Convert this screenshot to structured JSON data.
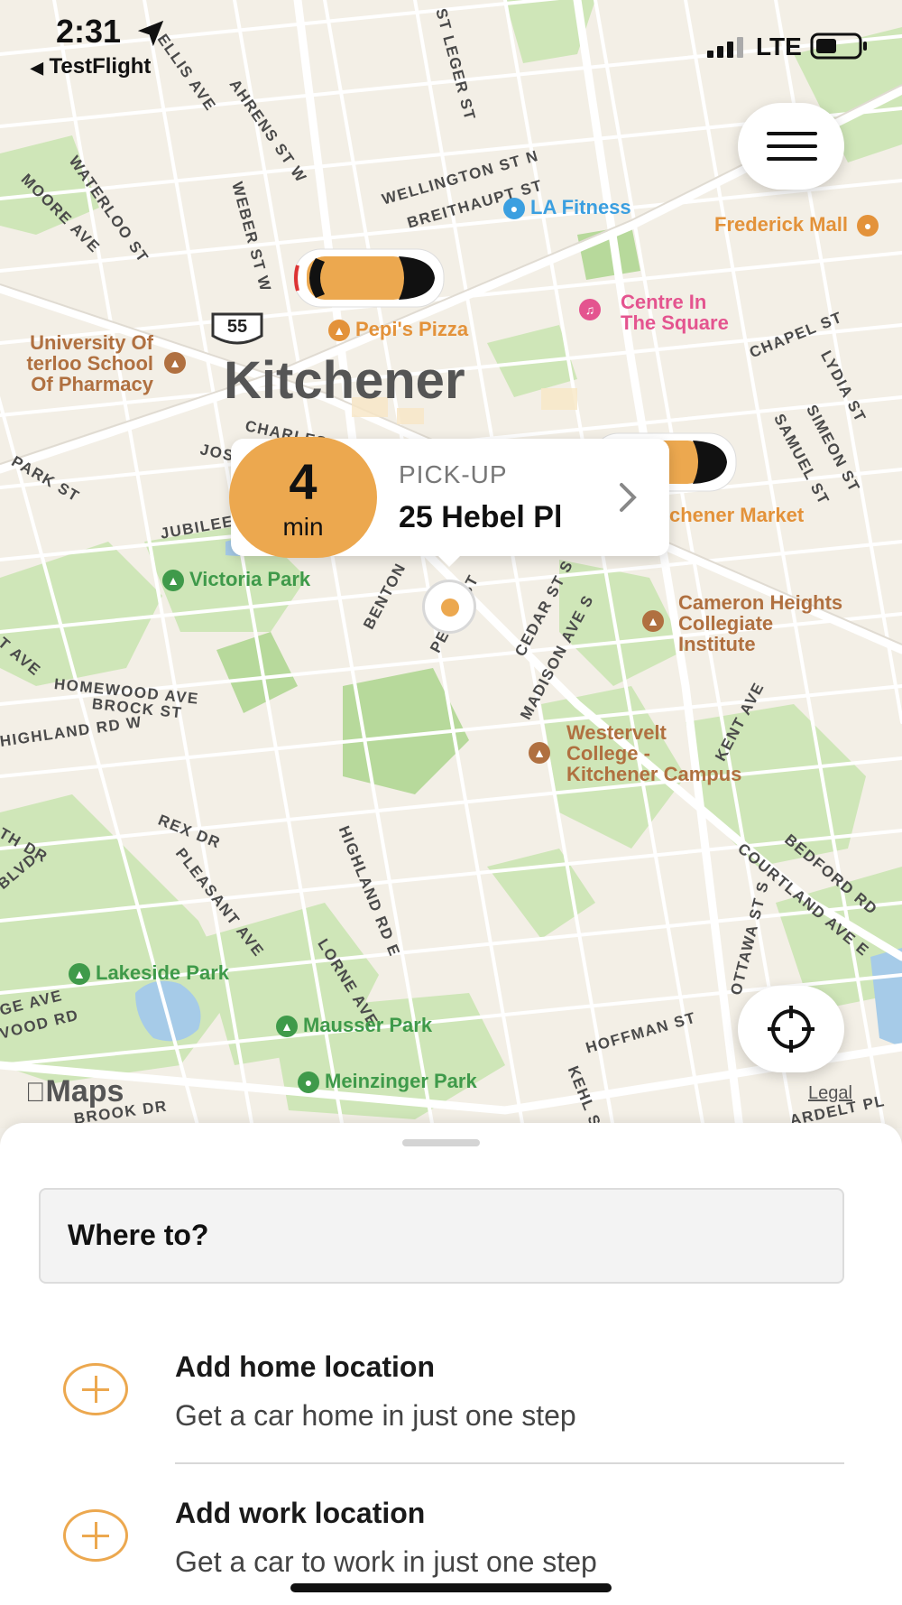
{
  "status_bar": {
    "time": "2:31",
    "back_app": "TestFlight",
    "network": "LTE"
  },
  "map": {
    "city_label": "Kitchener",
    "highway_shield": "55",
    "streets": [
      "WELLINGTON ST N",
      "BREITHAUPT ST",
      "WATERLOO ST",
      "MOORE AVE",
      "WEBER ST W",
      "AHRENS ST W",
      "ELLIS AVE",
      "ST LEGER ST",
      "CHAPEL ST",
      "LYDIA ST",
      "SIMEON ST",
      "SAMUEL ST",
      "CHARLES",
      "JOSEPH",
      "PARK ST",
      "JUBILEE",
      "BENTON",
      "PETER ST",
      "CEDAR ST S",
      "MADISON AVE S",
      "KENT AVE",
      "HOMEWOOD AVE",
      "BROCK ST",
      "HIGHLAND RD W",
      "REX DR",
      "PLEASANT AVE",
      "HIGHLAND RD E",
      "LORNE AVE",
      "OTTAWA ST S",
      "COURTLAND AVE E",
      "BEDFORD RD",
      "HOFFMAN ST",
      "KEHL ST",
      "ARDELT PL",
      "GE AVE",
      "VOOD RD",
      "BROOK DR",
      "TH DR",
      "BLVD",
      "T AVE"
    ],
    "pois": {
      "la_fitness": "LA Fitness",
      "frederick_mall": "Frederick Mall",
      "centre_in_the_square": [
        "Centre In",
        "The Square"
      ],
      "pepis_pizza": "Pepi's Pizza",
      "university": [
        "University Of",
        "terloo School",
        "Of Pharmacy"
      ],
      "market": "chener Market",
      "victoria_park": "Victoria Park",
      "cameron_heights": [
        "Cameron Heights",
        "Collegiate",
        "Institute"
      ],
      "westervelt": [
        "Westervelt",
        "College -",
        "Kitchener Campus"
      ],
      "lakeside_park": "Lakeside Park",
      "mausser_park": "Mausser Park",
      "meinzinger_park": "Meinzinger Park"
    },
    "attribution": "Maps",
    "legal": "Legal"
  },
  "pickup_callout": {
    "eta_value": "4",
    "eta_unit": "min",
    "label": "PICK-UP",
    "address": "25 Hebel Pl"
  },
  "bottom_sheet": {
    "search_placeholder": "Where to?",
    "home": {
      "title": "Add home location",
      "subtitle": "Get a car home in just one step"
    },
    "work": {
      "title": "Add work location",
      "subtitle": "Get a car to work in just one step"
    }
  },
  "colors": {
    "accent": "#eca84f",
    "park": "#cfe6b8",
    "water": "#a6cbe8",
    "road": "#ffffff"
  }
}
